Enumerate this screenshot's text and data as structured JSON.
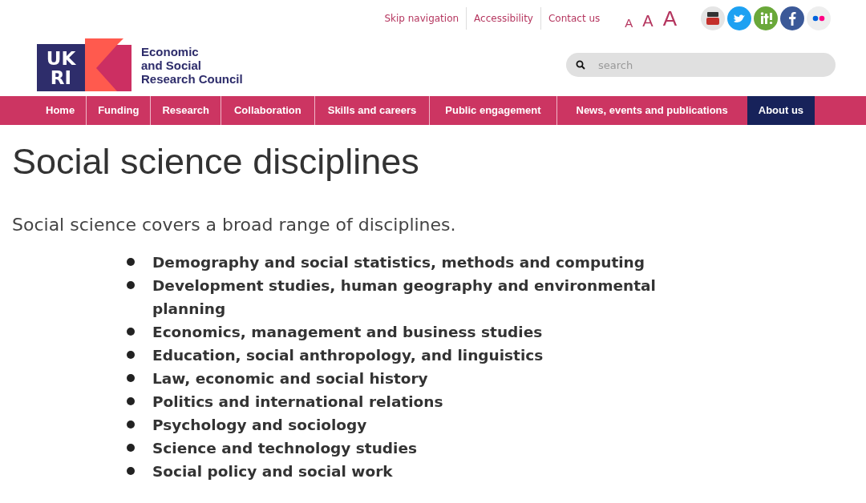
{
  "top_links": [
    "Skip navigation",
    "Accessibility",
    "Contact us"
  ],
  "text_sizes": [
    {
      "label": "A",
      "kind": "small"
    },
    {
      "label": "A",
      "kind": "medium"
    },
    {
      "label": "A",
      "kind": "large"
    }
  ],
  "social": [
    {
      "kind": "youtube"
    },
    {
      "kind": "twitter"
    },
    {
      "kind": "it"
    },
    {
      "kind": "facebook"
    },
    {
      "kind": "flickr"
    }
  ],
  "logo": {
    "mark": [
      "UK",
      "RI"
    ],
    "name": [
      "Economic",
      "and Social",
      "Research Council"
    ]
  },
  "search": {
    "placeholder": "search"
  },
  "nav": [
    {
      "label": "Home",
      "selected": false
    },
    {
      "label": "Funding",
      "selected": false
    },
    {
      "label": "Research",
      "selected": false
    },
    {
      "label": "Collaboration",
      "selected": false
    },
    {
      "label": "Skills and careers",
      "selected": false
    },
    {
      "label": "Public engagement",
      "selected": false
    },
    {
      "label": "News, events and publications",
      "selected": false
    },
    {
      "label": "About us",
      "selected": true
    }
  ],
  "title": "Social science disciplines",
  "intro": "Social science covers a broad range of disciplines.",
  "disciplines": [
    "Demography and social statistics, methods and computing",
    "Development studies, human geography and environmental planning",
    "Economics, management and business studies",
    "Education, social anthropology, and linguistics",
    "Law, economic and social history",
    "Politics and international relations",
    "Psychology and sociology",
    "Science and technology studies",
    "Social policy and social work"
  ]
}
